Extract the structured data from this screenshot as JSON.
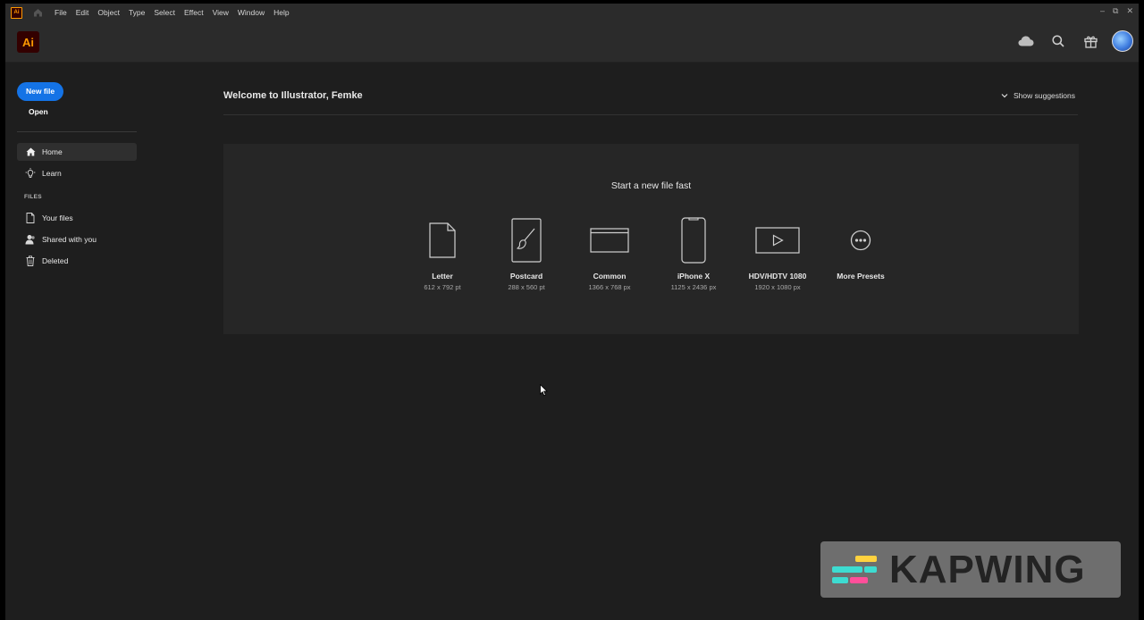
{
  "menubar": {
    "logo": "Ai",
    "items": [
      "File",
      "Edit",
      "Object",
      "Type",
      "Select",
      "Effect",
      "View",
      "Window",
      "Help"
    ],
    "window_controls": [
      "–",
      "⧉",
      "✕"
    ]
  },
  "appbar": {
    "logo": "Ai",
    "icons": [
      "cloud-icon",
      "search-icon",
      "gift-icon"
    ]
  },
  "sidebar": {
    "new_file": "New file",
    "open": "Open",
    "nav": [
      {
        "label": "Home",
        "icon": "home-icon",
        "active": true
      },
      {
        "label": "Learn",
        "icon": "lightbulb-icon"
      }
    ],
    "files_label": "FILES",
    "files": [
      {
        "label": "Your files",
        "icon": "file-icon"
      },
      {
        "label": "Shared with you",
        "icon": "people-icon"
      },
      {
        "label": "Deleted",
        "icon": "trash-icon"
      }
    ]
  },
  "main": {
    "welcome": "Welcome to Illustrator, Femke",
    "show_suggestions": "Show suggestions",
    "panel_title": "Start a new file fast",
    "presets": [
      {
        "name": "Letter",
        "size": "612 x 792 pt",
        "icon": "document-icon"
      },
      {
        "name": "Postcard",
        "size": "288 x 560 pt",
        "icon": "brush-icon"
      },
      {
        "name": "Common",
        "size": "1366 x 768 px",
        "icon": "browser-icon"
      },
      {
        "name": "iPhone X",
        "size": "1125 x 2436 px",
        "icon": "phone-icon"
      },
      {
        "name": "HDV/HDTV 1080",
        "size": "1920 x 1080 px",
        "icon": "video-icon"
      },
      {
        "name": "More Presets",
        "size": "",
        "icon": "more-icon"
      }
    ]
  },
  "watermark": {
    "text": "KAPWING"
  },
  "colors": {
    "accent": "#1473e6",
    "ai_bg": "#330000",
    "ai_fg": "#ff9a00"
  }
}
